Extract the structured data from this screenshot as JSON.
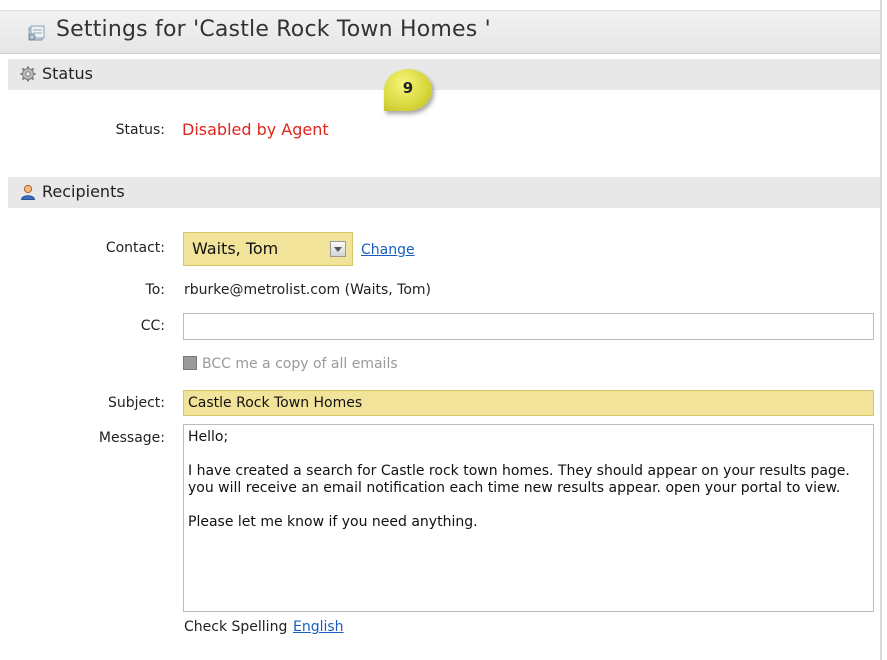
{
  "header": {
    "title": "Settings for 'Castle Rock Town Homes '"
  },
  "status_section": {
    "title": "Status",
    "status_label": "Status:",
    "status_value": "Disabled by Agent"
  },
  "badge": {
    "value": "9"
  },
  "recipients_section": {
    "title": "Recipients",
    "contact_label": "Contact:",
    "contact_value": "Waits, Tom",
    "change_link": "Change",
    "to_label": "To:",
    "to_value": "rburke@metrolist.com (Waits, Tom)",
    "cc_label": "CC:",
    "cc_value": "",
    "bcc_label": "BCC me a copy of all emails",
    "subject_label": "Subject:",
    "subject_value": "Castle Rock Town Homes",
    "message_label": "Message:",
    "message_value": "Hello;\n\nI have created a search for Castle rock town homes. They should appear on your results page. you will receive an email notification each time new results appear. open your portal to view.\n\nPlease let me know if you need anything.",
    "spell_label": "Check Spelling",
    "spell_language": "English"
  },
  "colors": {
    "status_red": "#e0261c",
    "highlight_yellow": "#f2e39a",
    "link_blue": "#1a5fbf"
  },
  "icons": {
    "title": "settings-document-icon",
    "status": "gear-icon",
    "recipients": "user-icon"
  }
}
